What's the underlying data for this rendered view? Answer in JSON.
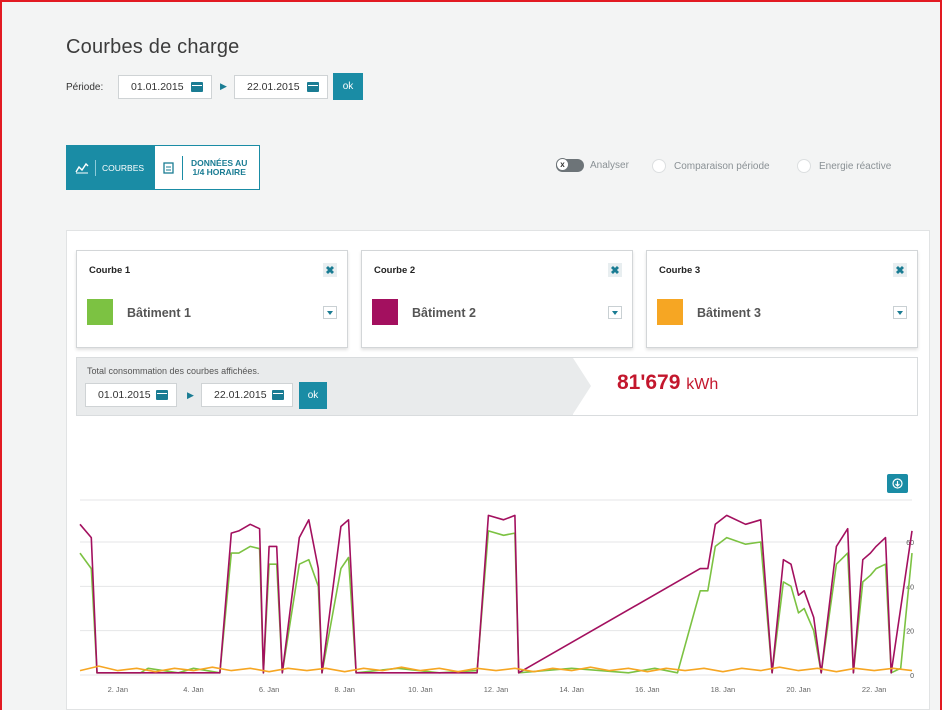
{
  "header": {
    "title": "Courbes de charge",
    "periode_label": "Période:",
    "date_from": "01.01.2015",
    "date_to": "22.01.2015",
    "ok_label": "ok"
  },
  "tabs": {
    "courbes": "COURBES",
    "donnees_line1": "DONNÉES AU",
    "donnees_line2": "1/4 HORAIRE"
  },
  "options": {
    "analyser": "Analyser",
    "comparaison": "Comparaison période",
    "energie": "Energie réactive"
  },
  "cards": [
    {
      "title": "Courbe 1",
      "label": "Bâtiment 1",
      "color": "#7cc242"
    },
    {
      "title": "Courbe 2",
      "label": "Bâtiment 2",
      "color": "#a3105f"
    },
    {
      "title": "Courbe 3",
      "label": "Bâtiment 3",
      "color": "#f6a623"
    }
  ],
  "total": {
    "label": "Total consommation des courbes affichées.",
    "date_from": "01.01.2015",
    "date_to": "22.01.2015",
    "ok_label": "ok",
    "value": "81'679",
    "unit": "kWh"
  },
  "chart_data": {
    "type": "line",
    "x_ticks": [
      "2. Jan",
      "4. Jan",
      "6. Jan",
      "8. Jan",
      "10. Jan",
      "12. Jan",
      "14. Jan",
      "16. Jan",
      "18. Jan",
      "20. Jan",
      "22. Jan"
    ],
    "y_ticks": [
      "0",
      "20",
      "40",
      "60"
    ],
    "ylim": [
      0,
      60
    ],
    "xlim": [
      1,
      23
    ],
    "series": [
      {
        "name": "Bâtiment 1",
        "color": "#7cc242",
        "points": [
          [
            1.0,
            55
          ],
          [
            1.3,
            48
          ],
          [
            1.45,
            1
          ],
          [
            2.6,
            1
          ],
          [
            2.8,
            3
          ],
          [
            3.6,
            1
          ],
          [
            4.0,
            3
          ],
          [
            4.7,
            1
          ],
          [
            5.0,
            55
          ],
          [
            5.2,
            55
          ],
          [
            5.5,
            58
          ],
          [
            5.75,
            57
          ],
          [
            5.85,
            1
          ],
          [
            6.0,
            50
          ],
          [
            6.2,
            50
          ],
          [
            6.35,
            1
          ],
          [
            6.8,
            50
          ],
          [
            7.05,
            52
          ],
          [
            7.3,
            40
          ],
          [
            7.4,
            1
          ],
          [
            7.9,
            48
          ],
          [
            8.1,
            53
          ],
          [
            8.3,
            1
          ],
          [
            9.4,
            3
          ],
          [
            10.5,
            1
          ],
          [
            11.5,
            2
          ],
          [
            11.8,
            65
          ],
          [
            12.2,
            63
          ],
          [
            12.5,
            64
          ],
          [
            12.6,
            1
          ],
          [
            14.0,
            3
          ],
          [
            15.5,
            1
          ],
          [
            16.2,
            3
          ],
          [
            16.8,
            1
          ],
          [
            17.4,
            38
          ],
          [
            17.6,
            38
          ],
          [
            17.8,
            58
          ],
          [
            18.1,
            62
          ],
          [
            18.6,
            59
          ],
          [
            19.0,
            60
          ],
          [
            19.3,
            1
          ],
          [
            19.6,
            42
          ],
          [
            19.8,
            40
          ],
          [
            20.0,
            28
          ],
          [
            20.15,
            30
          ],
          [
            20.4,
            20
          ],
          [
            20.6,
            1
          ],
          [
            21.0,
            50
          ],
          [
            21.3,
            55
          ],
          [
            21.45,
            1
          ],
          [
            21.7,
            42
          ],
          [
            21.9,
            45
          ],
          [
            22.05,
            48
          ],
          [
            22.3,
            50
          ],
          [
            22.45,
            1
          ],
          [
            22.7,
            3
          ],
          [
            23.0,
            55
          ]
        ]
      },
      {
        "name": "Bâtiment 2",
        "color": "#a3105f",
        "points": [
          [
            1.0,
            68
          ],
          [
            1.3,
            62
          ],
          [
            1.45,
            1
          ],
          [
            2.6,
            1
          ],
          [
            4.7,
            1
          ],
          [
            5.0,
            64
          ],
          [
            5.2,
            65
          ],
          [
            5.5,
            68
          ],
          [
            5.75,
            66
          ],
          [
            5.85,
            1
          ],
          [
            6.0,
            58
          ],
          [
            6.2,
            58
          ],
          [
            6.35,
            1
          ],
          [
            6.8,
            62
          ],
          [
            7.05,
            70
          ],
          [
            7.3,
            48
          ],
          [
            7.4,
            1
          ],
          [
            7.9,
            67
          ],
          [
            8.1,
            70
          ],
          [
            8.3,
            1
          ],
          [
            11.5,
            1
          ],
          [
            11.8,
            72
          ],
          [
            12.2,
            70
          ],
          [
            12.5,
            72
          ],
          [
            12.6,
            1
          ],
          [
            17.4,
            48
          ],
          [
            17.6,
            48
          ],
          [
            17.8,
            68
          ],
          [
            18.1,
            72
          ],
          [
            18.6,
            68
          ],
          [
            19.0,
            70
          ],
          [
            19.3,
            1
          ],
          [
            19.6,
            52
          ],
          [
            19.8,
            50
          ],
          [
            20.0,
            36
          ],
          [
            20.15,
            38
          ],
          [
            20.4,
            26
          ],
          [
            20.6,
            1
          ],
          [
            21.0,
            58
          ],
          [
            21.3,
            66
          ],
          [
            21.45,
            1
          ],
          [
            21.7,
            52
          ],
          [
            21.9,
            55
          ],
          [
            22.05,
            58
          ],
          [
            22.3,
            62
          ],
          [
            22.45,
            1
          ],
          [
            23.0,
            65
          ]
        ]
      },
      {
        "name": "Bâtiment 3",
        "color": "#f6a623",
        "points": [
          [
            1.0,
            2
          ],
          [
            1.5,
            4
          ],
          [
            2.0,
            2
          ],
          [
            2.5,
            3
          ],
          [
            3.0,
            1.5
          ],
          [
            3.5,
            3
          ],
          [
            4.0,
            2
          ],
          [
            4.5,
            3.5
          ],
          [
            5.0,
            2
          ],
          [
            5.5,
            3
          ],
          [
            6.0,
            1.5
          ],
          [
            6.5,
            3
          ],
          [
            7.0,
            2
          ],
          [
            7.5,
            3
          ],
          [
            8.0,
            1.5
          ],
          [
            8.5,
            3
          ],
          [
            9.0,
            2
          ],
          [
            9.5,
            3.5
          ],
          [
            10.0,
            2
          ],
          [
            10.5,
            3
          ],
          [
            11.0,
            1.5
          ],
          [
            11.5,
            3
          ],
          [
            12.0,
            2
          ],
          [
            12.5,
            3
          ],
          [
            13.0,
            1.5
          ],
          [
            13.5,
            3
          ],
          [
            14.0,
            2
          ],
          [
            14.5,
            3.5
          ],
          [
            15.0,
            2
          ],
          [
            15.5,
            3
          ],
          [
            16.0,
            1.5
          ],
          [
            16.5,
            3
          ],
          [
            17.0,
            2
          ],
          [
            17.5,
            3
          ],
          [
            18.0,
            1.5
          ],
          [
            18.5,
            3
          ],
          [
            19.0,
            2
          ],
          [
            19.5,
            3.5
          ],
          [
            20.0,
            2
          ],
          [
            20.5,
            3
          ],
          [
            21.0,
            1.5
          ],
          [
            21.5,
            3
          ],
          [
            22.0,
            2
          ],
          [
            22.5,
            3
          ],
          [
            23.0,
            2
          ]
        ]
      }
    ]
  }
}
